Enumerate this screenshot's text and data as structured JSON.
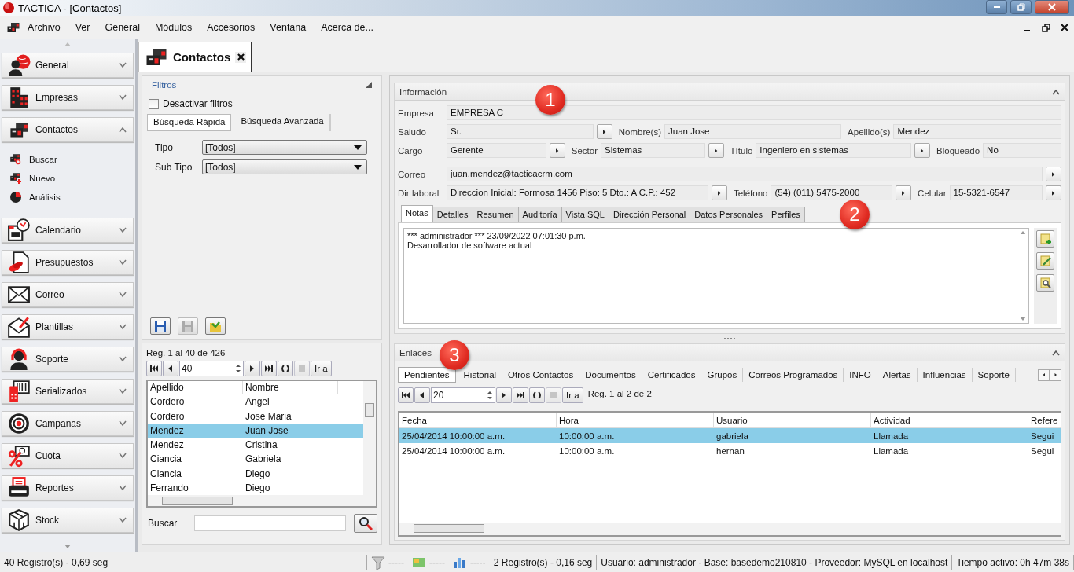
{
  "window": {
    "title": "TACTICA - [Contactos]"
  },
  "menu": [
    "Archivo",
    "Ver",
    "General",
    "Módulos",
    "Accesorios",
    "Ventana",
    "Acerca de..."
  ],
  "sidebar": {
    "groups": [
      {
        "label": "General",
        "expanded": false
      },
      {
        "label": "Empresas",
        "expanded": false
      },
      {
        "label": "Contactos",
        "expanded": true,
        "children": [
          {
            "label": "Buscar"
          },
          {
            "label": "Nuevo"
          },
          {
            "label": "Análisis"
          }
        ]
      },
      {
        "label": "Calendario",
        "expanded": false
      },
      {
        "label": "Presupuestos",
        "expanded": false
      },
      {
        "label": "Correo",
        "expanded": false
      },
      {
        "label": "Plantillas",
        "expanded": false
      },
      {
        "label": "Soporte",
        "expanded": false
      },
      {
        "label": "Serializados",
        "expanded": false
      },
      {
        "label": "Campañas",
        "expanded": false
      },
      {
        "label": "Cuota",
        "expanded": false
      },
      {
        "label": "Reportes",
        "expanded": false
      },
      {
        "label": "Stock",
        "expanded": false
      }
    ]
  },
  "document_tab": {
    "label": "Contactos"
  },
  "filters": {
    "title": "Filtros",
    "disable_filters": {
      "label": "Desactivar filtros",
      "checked": false
    },
    "tabs": [
      {
        "label": "Búsqueda Rápida",
        "selected": true
      },
      {
        "label": "Búsqueda Avanzada",
        "selected": false
      }
    ],
    "fields": [
      {
        "label": "Tipo",
        "value": "[Todos]"
      },
      {
        "label": "Sub Tipo",
        "value": "[Todos]"
      }
    ],
    "actions": [
      {
        "disabled": false
      },
      {
        "disabled": true
      },
      {
        "disabled": false
      }
    ]
  },
  "list": {
    "record_info": "Reg. 1 al 40 de 426",
    "pager": {
      "page_size": "40",
      "go_label": "Ir a"
    },
    "columns": [
      "Apellido",
      "Nombre"
    ],
    "rows": [
      {
        "cells": [
          "Cordero",
          "Angel"
        ],
        "selected": false
      },
      {
        "cells": [
          "Cordero",
          "Jose Maria"
        ],
        "selected": false
      },
      {
        "cells": [
          "Mendez",
          "Juan Jose"
        ],
        "selected": true
      },
      {
        "cells": [
          "Mendez",
          "Cristina"
        ],
        "selected": false
      },
      {
        "cells": [
          "Ciancia",
          "Gabriela"
        ],
        "selected": false
      },
      {
        "cells": [
          "Ciancia",
          "Diego"
        ],
        "selected": false
      },
      {
        "cells": [
          "Ferrando",
          "Diego"
        ],
        "selected": false
      }
    ],
    "search": {
      "label": "Buscar"
    }
  },
  "info": {
    "title": "Información",
    "rows": [
      [
        {
          "label": "Empresa",
          "value": "EMPRESA C",
          "button": false
        }
      ],
      [
        {
          "label": "Saludo",
          "value": "Sr.",
          "button": true
        },
        {
          "label": "Nombre(s)",
          "value": "Juan Jose",
          "button": false
        },
        {
          "label": "Apellido(s)",
          "value": "Mendez",
          "button": false
        }
      ],
      [
        {
          "label": "Cargo",
          "value": "Gerente",
          "button": true
        },
        {
          "label": "Sector",
          "value": "Sistemas",
          "button": true
        },
        {
          "label": "Título",
          "value": "Ingeniero en sistemas",
          "button": true
        },
        {
          "label": "Bloqueado",
          "value": "No",
          "button": false
        }
      ],
      [
        {
          "label": "Correo",
          "value": "juan.mendez@tacticacrm.com",
          "button": true
        }
      ],
      [
        {
          "label": "Dir laboral",
          "value": "Direccion Inicial: Formosa 1456 Piso: 5 Dto.: A C.P.: 452",
          "button": true
        },
        {
          "label": "Teléfono",
          "value": "(54) (011) 5475-2000",
          "button": true
        },
        {
          "label": "Celular",
          "value": "15-5321-6547",
          "button": true
        }
      ]
    ],
    "tabs": [
      {
        "label": "Notas",
        "selected": true
      },
      {
        "label": "Detalles",
        "selected": false
      },
      {
        "label": "Resumen",
        "selected": false
      },
      {
        "label": "Auditoría",
        "selected": false
      },
      {
        "label": "Vista SQL",
        "selected": false
      },
      {
        "label": "Dirección Personal",
        "selected": false
      },
      {
        "label": "Datos Personales",
        "selected": false
      },
      {
        "label": "Perfiles",
        "selected": false
      }
    ],
    "notes": [
      "*** administrador *** 23/09/2022 07:01:30 p.m.",
      "Desarrollador de software actual"
    ]
  },
  "links": {
    "title": "Enlaces",
    "tabs": [
      {
        "label": "Pendientes",
        "selected": true
      },
      {
        "label": "Historial",
        "selected": false
      },
      {
        "label": "Otros Contactos",
        "selected": false
      },
      {
        "label": "Documentos",
        "selected": false
      },
      {
        "label": "Certificados",
        "selected": false
      },
      {
        "label": "Grupos",
        "selected": false
      },
      {
        "label": "Correos Programados",
        "selected": false
      },
      {
        "label": "INFO",
        "selected": false
      },
      {
        "label": "Alertas",
        "selected": false
      },
      {
        "label": "Influencias",
        "selected": false
      },
      {
        "label": "Soporte",
        "selected": false
      }
    ],
    "pager": {
      "page_size": "20",
      "go_label": "Ir a"
    },
    "record_info": "Reg. 1 al 2 de 2",
    "columns": [
      "Fecha",
      "Hora",
      "Usuario",
      "Actividad",
      "Refere"
    ],
    "rows": [
      {
        "cells": [
          "25/04/2014 10:00:00 a.m.",
          "10:00:00 a.m.",
          "gabriela",
          "Llamada",
          "Segui"
        ],
        "selected": true
      },
      {
        "cells": [
          "25/04/2014 10:00:00 a.m.",
          "10:00:00 a.m.",
          "hernan",
          "Llamada",
          "Segui"
        ],
        "selected": false
      }
    ]
  },
  "annotations": [
    "1",
    "2",
    "3"
  ],
  "status_bar": {
    "left": "40 Registro(s) - 0,69 seg",
    "counters": [
      "-----",
      "-----",
      "-----"
    ],
    "records": "2 Registro(s) - 0,16 seg",
    "connection": "Usuario: administrador - Base: basedemo210810 - Proveedor: MySQL en localhost",
    "uptime": "Tiempo activo: 0h 47m 38s"
  }
}
